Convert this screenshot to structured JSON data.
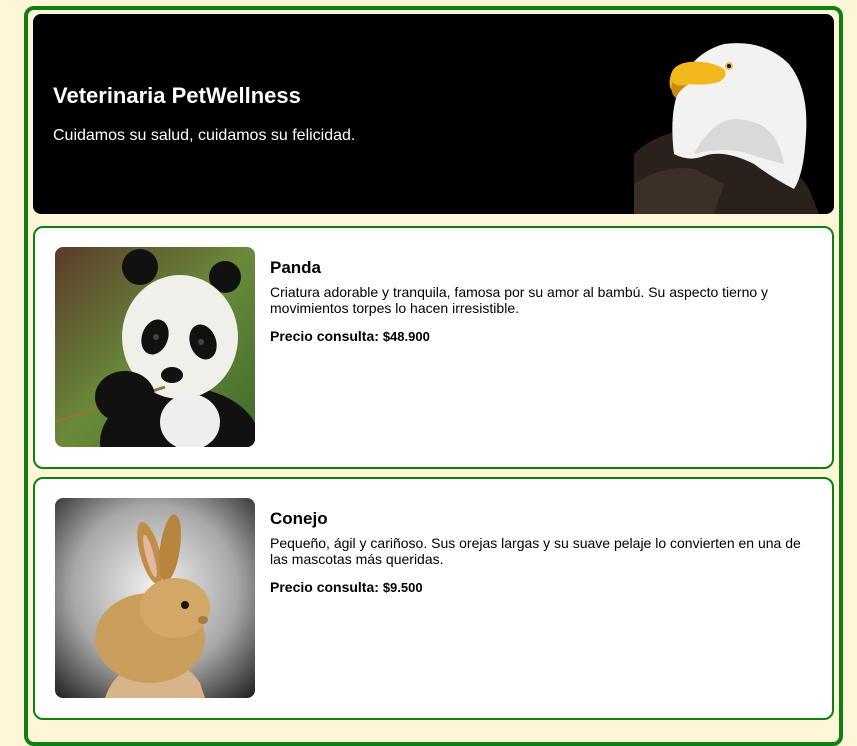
{
  "header": {
    "title": "Veterinaria PetWellness",
    "subtitle": "Cuidamos su salud, cuidamos su felicidad.",
    "image_icon": "eagle-image"
  },
  "cards": [
    {
      "name": "Panda",
      "description": "Criatura adorable y tranquila, famosa por su amor al bambú. Su aspecto tierno y movimientos torpes lo hacen irresistible.",
      "price_label": "Precio consulta:",
      "price_value": "$48.900",
      "image_icon": "panda-image"
    },
    {
      "name": "Conejo",
      "description": "Pequeño, ágil y cariñoso. Sus orejas largas y su suave pelaje lo convierten en una de las mascotas más queridas.",
      "price_label": "Precio consulta:",
      "price_value": "$9.500",
      "image_icon": "rabbit-image"
    }
  ],
  "colors": {
    "page_background": "#fdf6d8",
    "accent_border": "#0f7f0f",
    "header_background": "#000000"
  }
}
